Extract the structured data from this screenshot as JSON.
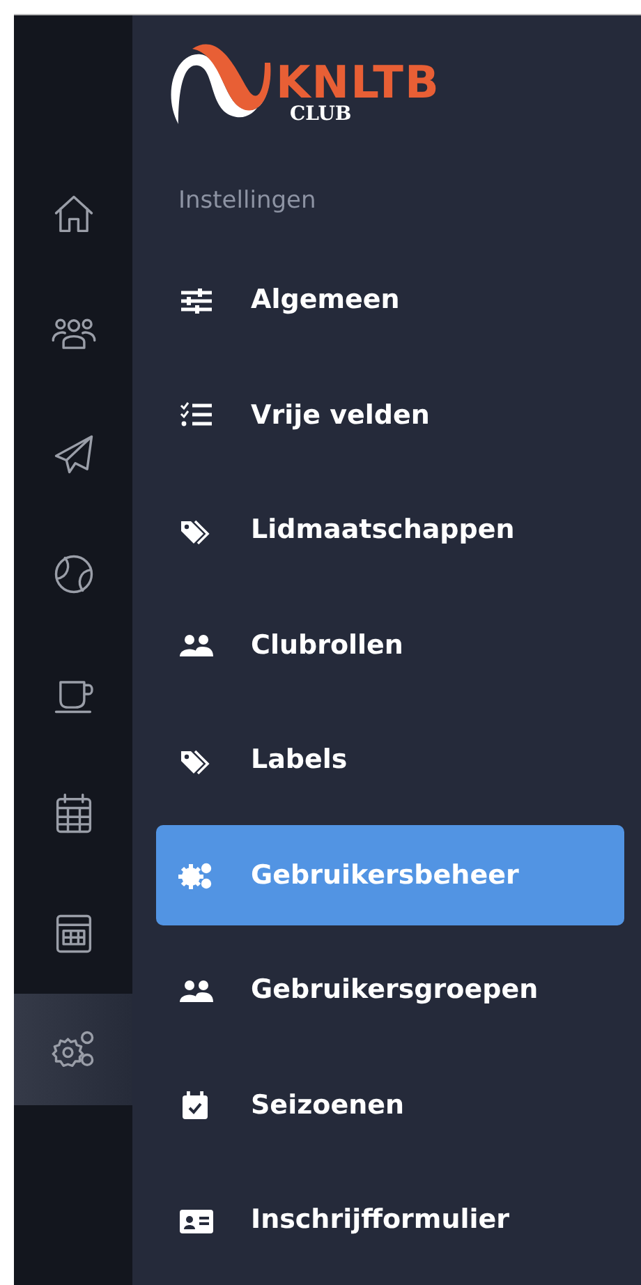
{
  "logo": {
    "wordmark": "KNLTB",
    "subtitle": "CLUB"
  },
  "rail": [
    {
      "selected": false
    },
    {
      "selected": false
    },
    {
      "selected": false
    },
    {
      "selected": false
    },
    {
      "selected": false
    },
    {
      "selected": false
    },
    {
      "selected": false
    },
    {
      "selected": true
    }
  ],
  "section_title": "Instellingen",
  "menu": [
    {
      "label": "Algemeen",
      "selected": false
    },
    {
      "label": "Vrije velden",
      "selected": false
    },
    {
      "label": "Lidmaatschappen",
      "selected": false
    },
    {
      "label": "Clubrollen",
      "selected": false
    },
    {
      "label": "Labels",
      "selected": false
    },
    {
      "label": "Gebruikersbeheer",
      "selected": true
    },
    {
      "label": "Gebruikersgroepen",
      "selected": false
    },
    {
      "label": "Seizoenen",
      "selected": false
    },
    {
      "label": "Inschrijfformulier",
      "selected": false
    }
  ]
}
